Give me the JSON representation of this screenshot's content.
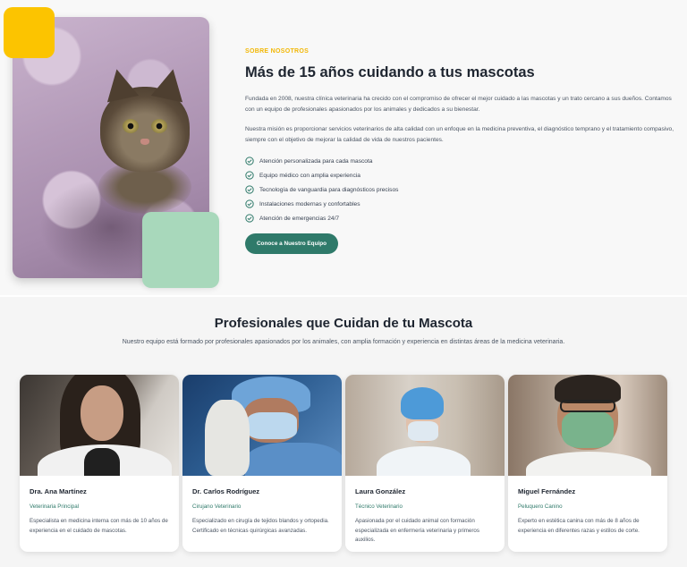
{
  "about": {
    "eyebrow": "SOBRE NOSOTROS",
    "title": "Más de 15 años cuidando a tus mascotas",
    "paragraph_1": "Fundada en 2008, nuestra clínica veterinaria ha crecido con el compromiso de ofrecer el mejor cuidado a las mascotas y un trato cercano a sus dueños. Contamos con un equipo de profesionales apasionados por los animales y dedicados a su bienestar.",
    "paragraph_2": "Nuestra misión es proporcionar servicios veterinarios de alta calidad con un enfoque en la medicina preventiva, el diagnóstico temprano y el tratamiento compasivo, siempre con el objetivo de mejorar la calidad de vida de nuestros pacientes.",
    "features": [
      "Atención personalizada para cada mascota",
      "Equipo médico con amplia experiencia",
      "Tecnología de vanguardia para diagnósticos precisos",
      "Instalaciones modernas y confortables",
      "Atención de emergencias 24/7"
    ],
    "cta_label": "Conoce a Nuestro Equipo"
  },
  "team": {
    "title": "Profesionales que Cuidan de tu Mascota",
    "subtitle": "Nuestro equipo está formado por profesionales apasionados por los animales, con amplia formación y experiencia en distintas áreas de la medicina veterinaria.",
    "members": [
      {
        "name": "Dra. Ana Martínez",
        "role": "Veterinaria Principal",
        "description": "Especialista en medicina interna con más de 10 años de experiencia en el cuidado de mascotas."
      },
      {
        "name": "Dr. Carlos Rodríguez",
        "role": "Cirujano Veterinario",
        "description": "Especializado en cirugía de tejidos blandos y ortopedia. Certificado en técnicas quirúrgicas avanzadas."
      },
      {
        "name": "Laura González",
        "role": "Técnico Veterinario",
        "description": "Apasionada por el cuidado animal con formación especializada en enfermería veterinaria y primeros auxilios."
      },
      {
        "name": "Miguel Fernández",
        "role": "Peluquero Canino",
        "description": "Experto en estética canina con más de 8 años de experiencia en diferentes razas y estilos de corte."
      }
    ]
  },
  "colors": {
    "accent_yellow": "#fcc400",
    "accent_green": "#2f7a6a",
    "mint": "#a8d8bb"
  }
}
